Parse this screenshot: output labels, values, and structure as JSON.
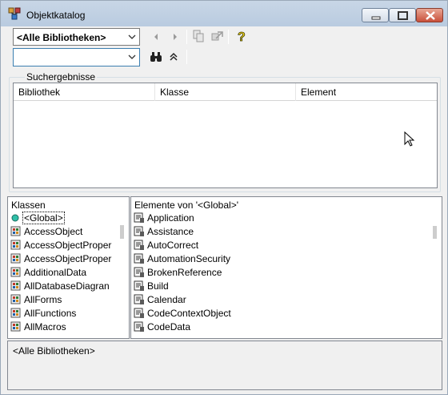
{
  "window": {
    "title": "Objektkatalog",
    "icon": "object-browser-icon",
    "controls": [
      "minimize-icon",
      "maximize-icon",
      "close-icon"
    ]
  },
  "toolbar": {
    "library_value": "<Alle Bibliotheken>",
    "search_value": "",
    "icons": [
      "back-icon",
      "forward-icon",
      "copy-icon",
      "view-definition-icon",
      "help-icon",
      "binoculars-icon",
      "collapse-icon"
    ]
  },
  "results": {
    "group_label": "Suchergebnisse",
    "columns": [
      "Bibliothek",
      "Klasse",
      "Element"
    ],
    "rows": []
  },
  "classes": {
    "title": "Klassen",
    "items": [
      {
        "label": "<Global>",
        "icon": "globe-icon",
        "selected": true
      },
      {
        "label": "AccessObject",
        "icon": "class-icon"
      },
      {
        "label": "AccessObjectProper",
        "icon": "class-icon"
      },
      {
        "label": "AccessObjectProper",
        "icon": "class-icon"
      },
      {
        "label": "AdditionalData",
        "icon": "class-icon"
      },
      {
        "label": "AllDatabaseDiagran",
        "icon": "class-icon"
      },
      {
        "label": "AllForms",
        "icon": "class-icon"
      },
      {
        "label": "AllFunctions",
        "icon": "class-icon"
      },
      {
        "label": "AllMacros",
        "icon": "class-icon"
      }
    ]
  },
  "members": {
    "title": "Elemente von '<Global>'",
    "items": [
      {
        "label": "Application",
        "icon": "property-icon"
      },
      {
        "label": "Assistance",
        "icon": "property-icon"
      },
      {
        "label": "AutoCorrect",
        "icon": "property-icon"
      },
      {
        "label": "AutomationSecurity",
        "icon": "property-icon"
      },
      {
        "label": "BrokenReference",
        "icon": "property-icon"
      },
      {
        "label": "Build",
        "icon": "property-icon"
      },
      {
        "label": "Calendar",
        "icon": "property-icon"
      },
      {
        "label": "CodeContextObject",
        "icon": "property-icon"
      },
      {
        "label": "CodeData",
        "icon": "property-icon"
      }
    ]
  },
  "details": {
    "text": "<Alle Bibliotheken>"
  },
  "colors": {
    "titlebar": "#c8d6e6",
    "selection_outline": "#000000",
    "close_button": "#c9503b"
  }
}
